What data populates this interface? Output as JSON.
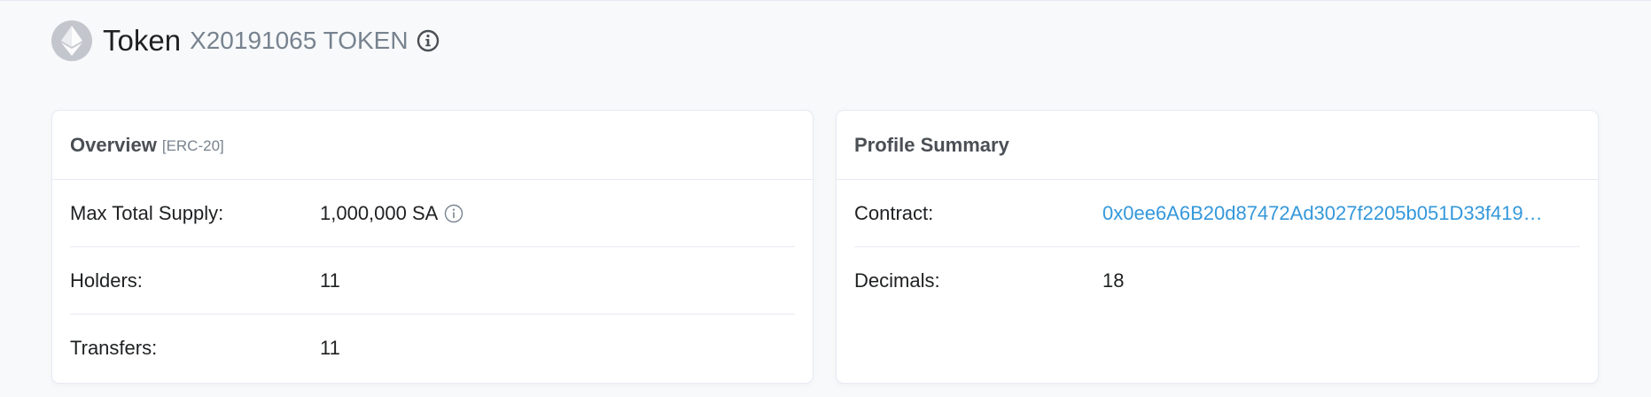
{
  "header": {
    "title": "Token",
    "subtitle": "X20191065 TOKEN",
    "logo_icon": "ethereum-icon",
    "info_icon": "info-circle-icon"
  },
  "overview": {
    "title": "Overview",
    "tag": "[ERC-20]",
    "rows": [
      {
        "label": "Max Total Supply:",
        "value": "1,000,000 SA"
      },
      {
        "label": "Holders:",
        "value": "11"
      },
      {
        "label": "Transfers:",
        "value": "11"
      }
    ]
  },
  "profile": {
    "title": "Profile Summary",
    "rows": [
      {
        "label": "Contract:",
        "value": "0x0ee6A6B20d87472Ad3027f2205b051D33f419…"
      },
      {
        "label": "Decimals:",
        "value": "18"
      }
    ]
  },
  "colors": {
    "link": "#3498db",
    "border": "#e7eaf3",
    "background": "#f8f9fa",
    "muted": "#77838f"
  }
}
